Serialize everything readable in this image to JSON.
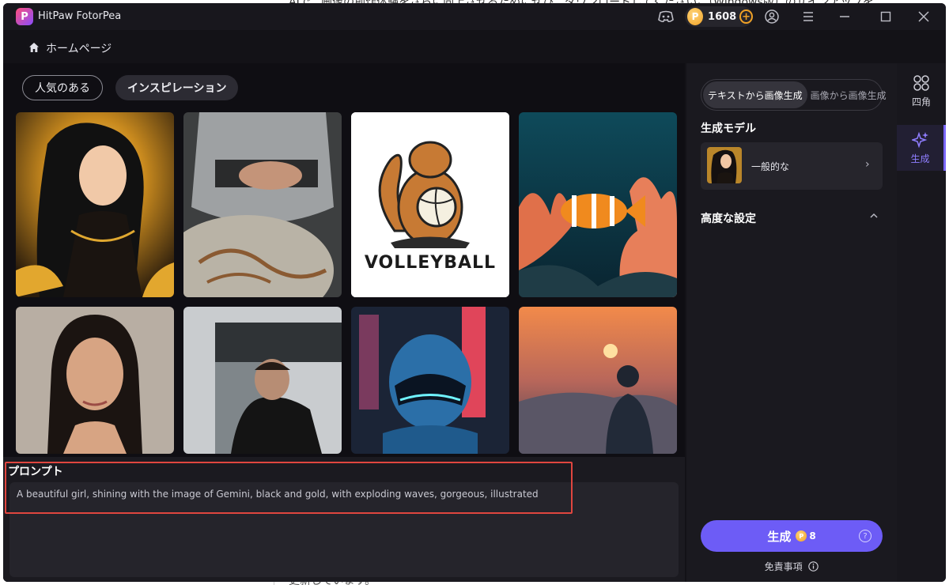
{
  "background_doc": {
    "top_text": "AIで、画像の創作体験をさらに向上させるためにぜひ、ダウンロードしてください。（Windows版）のサインアップを",
    "bottom_text": "更新しています。"
  },
  "app": {
    "title": "HitPaw FotorPea",
    "logo_letter": "P"
  },
  "titlebar": {
    "coin_count": "1608",
    "coin_symbol": "P",
    "icons": [
      "discord-icon",
      "coin-icon",
      "add-coins-icon",
      "account-icon",
      "menu-icon",
      "minimize-icon",
      "maximize-icon",
      "close-icon"
    ]
  },
  "breadcrumb": {
    "label": "ホームページ"
  },
  "tabs": [
    {
      "label": "人気のある",
      "active": false
    },
    {
      "label": "インスピレーション",
      "active": true
    }
  ],
  "gallery": [
    {
      "name": "gemini-girl"
    },
    {
      "name": "knight"
    },
    {
      "name": "volleyball-squirrel",
      "caption": "VOLLEYBALL"
    },
    {
      "name": "clownfish"
    },
    {
      "name": "portrait-woman"
    },
    {
      "name": "street-man"
    },
    {
      "name": "cyber-robot"
    },
    {
      "name": "sunset-boy"
    }
  ],
  "prompt": {
    "title": "プロンプト",
    "text": "A beautiful girl, shining with the image of Gemini, black and gold, with exploding waves, gorgeous, illustrated"
  },
  "right_panel": {
    "mode_options": [
      "テキストから画像生成",
      "画像から画像生成"
    ],
    "active_mode": 0,
    "model_section_title": "生成モデル",
    "model_name": "一般的な",
    "advanced_title": "高度な設定",
    "generate_label": "生成",
    "generate_cost": "8",
    "help_symbol": "?",
    "disclaimer": "免責事項"
  },
  "sidebar": [
    {
      "label": "四角",
      "icon": "grid-icon",
      "active": false
    },
    {
      "label": "生成",
      "icon": "sparkle-icon",
      "active": true
    }
  ],
  "colors": {
    "accent": "#6d5cf6",
    "highlight_border": "#e0463f",
    "coin": "#f0a125",
    "window_bg": "#131217"
  }
}
